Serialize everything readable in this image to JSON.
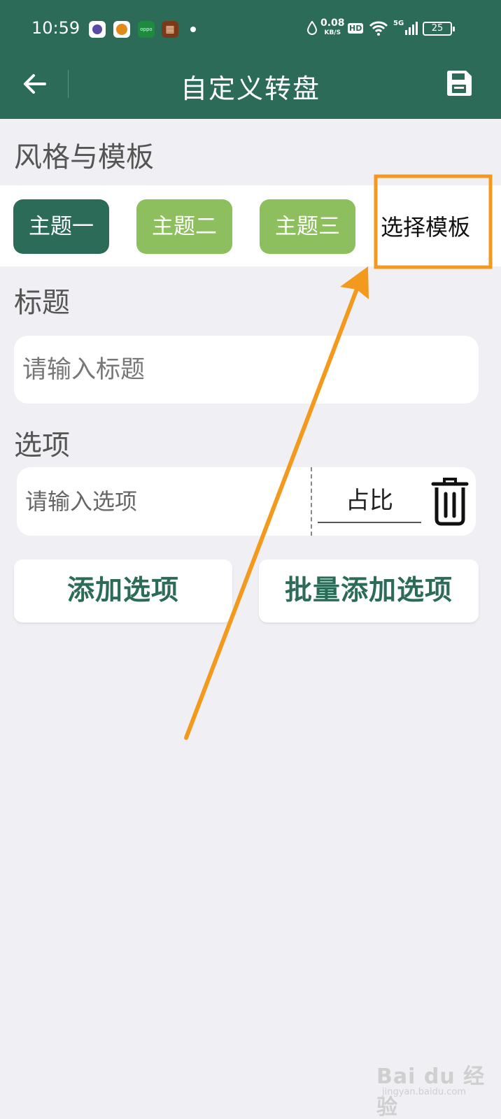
{
  "status_bar": {
    "time": "10:59",
    "app_icons": [
      "browser-icon",
      "basketball-icon",
      "oppo-icon",
      "game-icon"
    ],
    "oppo_label": "oppo",
    "net_speed": "0.08",
    "net_speed_unit": "KB/S",
    "hd_label": "HD",
    "network_label": "5G",
    "battery": "25"
  },
  "nav": {
    "back_icon": "arrow-left-icon",
    "title": "自定义转盘",
    "save_icon": "save-icon"
  },
  "style_section": {
    "heading": "风格与模板",
    "themes": [
      "主题一",
      "主题二",
      "主题三"
    ],
    "template_button": "选择模板"
  },
  "title_section": {
    "heading": "标题",
    "input_value": "",
    "input_placeholder": "请输入标题"
  },
  "options_section": {
    "heading": "选项",
    "option_value": "",
    "option_placeholder": "请输入选项",
    "ratio_value": "",
    "ratio_placeholder": "占比",
    "delete_icon": "trash-icon"
  },
  "actions": {
    "add_option": "添加选项",
    "bulk_add_option": "批量添加选项"
  },
  "annotation": {
    "highlight_color": "#f39a1e",
    "arrow_icon": "arrow-up-right-icon"
  },
  "watermark": {
    "brand": "Bai du 经验",
    "url": "jingyan.baidu.com"
  },
  "colors": {
    "primary": "#2c6b58",
    "theme_light": "#8dbf5f",
    "background": "#f0eff3"
  }
}
